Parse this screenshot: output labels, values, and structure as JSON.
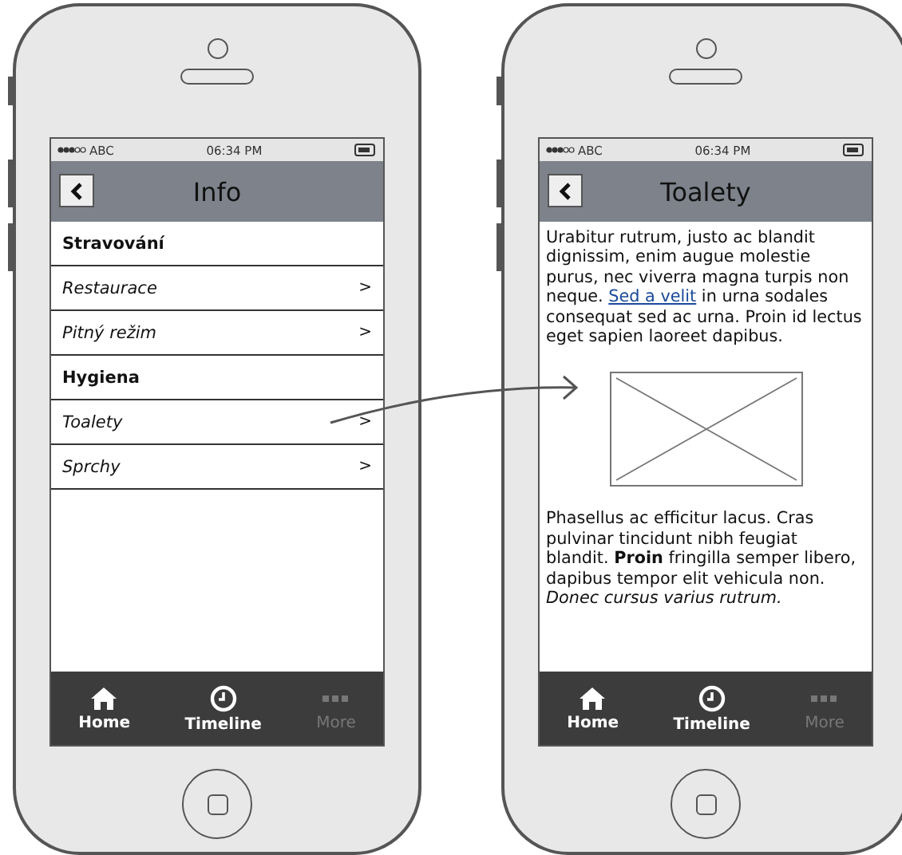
{
  "phones": [
    {
      "status": {
        "carrier": "ABC",
        "time": "06:34 PM"
      },
      "nav": {
        "title": "Info"
      },
      "content": [
        {
          "kind": "header",
          "label": "Stravování"
        },
        {
          "kind": "link",
          "label": "Restaurace",
          "chevron": ">"
        },
        {
          "kind": "link",
          "label": "Pitný režim",
          "chevron": ">"
        },
        {
          "kind": "header",
          "label": "Hygiena"
        },
        {
          "kind": "link",
          "label": "Toalety",
          "chevron": ">"
        },
        {
          "kind": "link",
          "label": "Sprchy",
          "chevron": ">"
        }
      ],
      "tabs": [
        {
          "kind": "home",
          "label": "Home",
          "disabled": false
        },
        {
          "kind": "clock",
          "label": "Timeline",
          "disabled": false
        },
        {
          "kind": "dots",
          "label": "More",
          "disabled": true
        }
      ]
    },
    {
      "status": {
        "carrier": "ABC",
        "time": "06:34 PM"
      },
      "nav": {
        "title": "Toalety"
      },
      "content": [
        {
          "kind": "paragraph",
          "before": "Urabitur rutrum, justo ac blandit dignissim, enim augue molestie purus, nec viverra magna turpis non neque.",
          "link": "Sed a velit",
          "after": "in urna sodales consequat sed ac urna. Proin id lectus eget sapien laoreet dapibus."
        },
        {
          "kind": "image"
        },
        {
          "kind": "paragraph",
          "before": "Phasellus ac efficitur lacus. Cras pulvinar tincidunt nibh feugiat blandit. **Proin** fringilla semper libero, dapibus tempor elit vehicula non. *Donec cursus varius rutrum.*"
        }
      ],
      "tabs": [
        {
          "kind": "home",
          "label": "Home",
          "disabled": false
        },
        {
          "kind": "clock",
          "label": "Timeline",
          "disabled": false
        },
        {
          "kind": "dots",
          "label": "More",
          "disabled": true
        }
      ]
    }
  ]
}
